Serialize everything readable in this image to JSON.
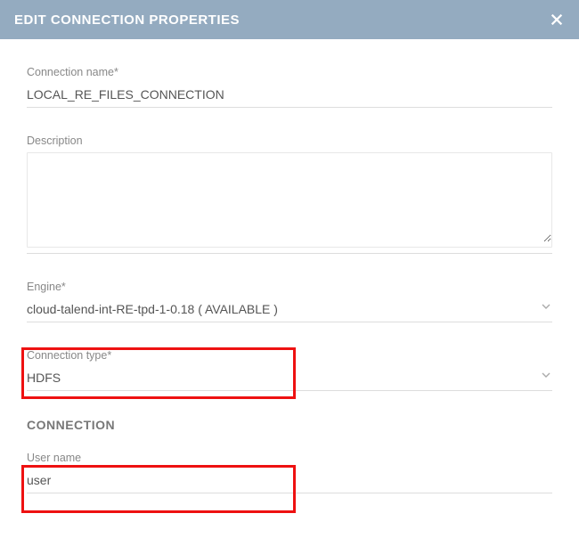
{
  "header": {
    "title": "EDIT CONNECTION PROPERTIES"
  },
  "fields": {
    "connection_name": {
      "label": "Connection name*",
      "value": "LOCAL_RE_FILES_CONNECTION"
    },
    "description": {
      "label": "Description",
      "value": ""
    },
    "engine": {
      "label": "Engine*",
      "value": "cloud-talend-int-RE-tpd-1-0.18 ( AVAILABLE )"
    },
    "connection_type": {
      "label": "Connection type*",
      "value": "HDFS"
    }
  },
  "section": {
    "title": "CONNECTION"
  },
  "conn_fields": {
    "user_name": {
      "label": "User name",
      "value": "user"
    }
  }
}
